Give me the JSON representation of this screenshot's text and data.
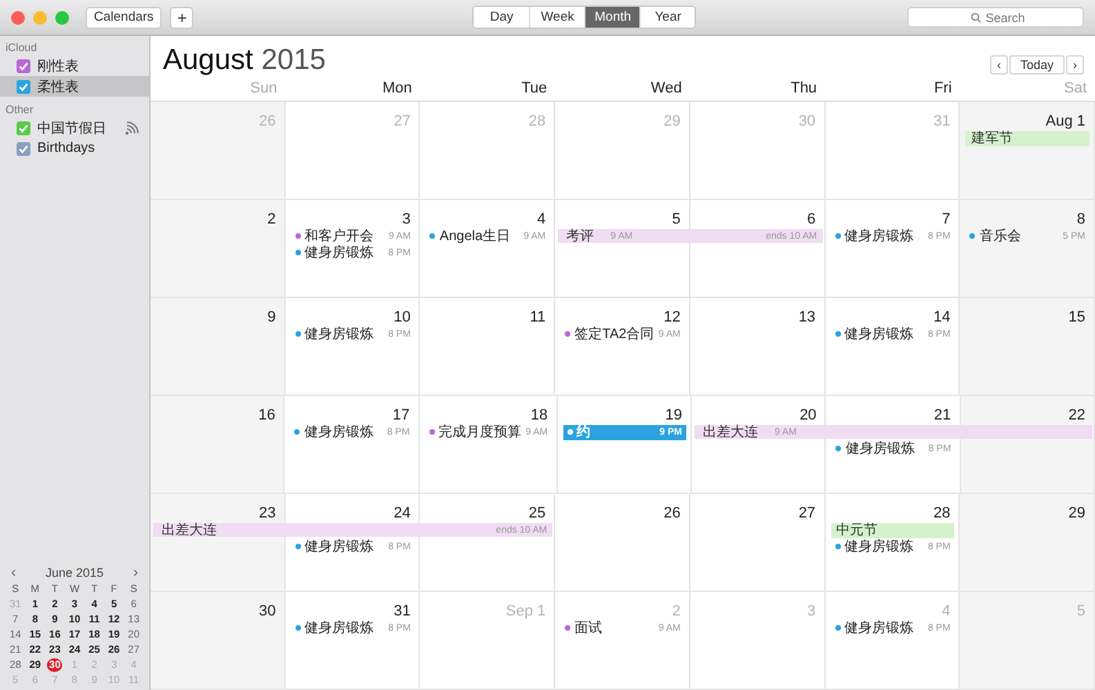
{
  "toolbar": {
    "calendars_button": "Calendars",
    "add_button": "+",
    "views": [
      {
        "label": "Day",
        "selected": false
      },
      {
        "label": "Week",
        "selected": false
      },
      {
        "label": "Month",
        "selected": true
      },
      {
        "label": "Year",
        "selected": false
      }
    ],
    "search": {
      "placeholder": "Search"
    }
  },
  "sidebar": {
    "groups": [
      {
        "title": "iCloud",
        "calendars": [
          {
            "name": "刚性表",
            "color": "#b968d6",
            "checked": true,
            "selected": false,
            "kind": "local"
          },
          {
            "name": "柔性表",
            "color": "#2aa3e0",
            "checked": true,
            "selected": true,
            "kind": "local"
          }
        ]
      },
      {
        "title": "Other",
        "calendars": [
          {
            "name": "中国节假日",
            "color": "#5cc94a",
            "checked": true,
            "selected": false,
            "kind": "subscribed"
          },
          {
            "name": "Birthdays",
            "color": "#8a9fbd",
            "checked": true,
            "selected": false,
            "kind": "local"
          }
        ]
      }
    ],
    "mini_calendar": {
      "title": "June 2015",
      "prev": "‹",
      "next": "›",
      "weekdays": [
        "S",
        "M",
        "T",
        "W",
        "T",
        "F",
        "S"
      ],
      "weeks": [
        [
          {
            "d": "31",
            "muted": true,
            "today": false
          },
          {
            "d": "1",
            "muted": false,
            "today": false
          },
          {
            "d": "2",
            "muted": false,
            "today": false
          },
          {
            "d": "3",
            "muted": false,
            "today": false
          },
          {
            "d": "4",
            "muted": false,
            "today": false
          },
          {
            "d": "5",
            "muted": false,
            "today": false
          },
          {
            "d": "6",
            "muted": false,
            "today": false
          }
        ],
        [
          {
            "d": "7",
            "muted": false,
            "today": false
          },
          {
            "d": "8",
            "muted": false,
            "today": false
          },
          {
            "d": "9",
            "muted": false,
            "today": false
          },
          {
            "d": "10",
            "muted": false,
            "today": false
          },
          {
            "d": "11",
            "muted": false,
            "today": false
          },
          {
            "d": "12",
            "muted": false,
            "today": false
          },
          {
            "d": "13",
            "muted": false,
            "today": false
          }
        ],
        [
          {
            "d": "14",
            "muted": false,
            "today": false
          },
          {
            "d": "15",
            "muted": false,
            "today": false
          },
          {
            "d": "16",
            "muted": false,
            "today": false
          },
          {
            "d": "17",
            "muted": false,
            "today": false
          },
          {
            "d": "18",
            "muted": false,
            "today": false
          },
          {
            "d": "19",
            "muted": false,
            "today": false
          },
          {
            "d": "20",
            "muted": false,
            "today": false
          }
        ],
        [
          {
            "d": "21",
            "muted": false,
            "today": false
          },
          {
            "d": "22",
            "muted": false,
            "today": false
          },
          {
            "d": "23",
            "muted": false,
            "today": false
          },
          {
            "d": "24",
            "muted": false,
            "today": false
          },
          {
            "d": "25",
            "muted": false,
            "today": false
          },
          {
            "d": "26",
            "muted": false,
            "today": false
          },
          {
            "d": "27",
            "muted": false,
            "today": false
          }
        ],
        [
          {
            "d": "28",
            "muted": false,
            "today": false
          },
          {
            "d": "29",
            "muted": false,
            "today": false
          },
          {
            "d": "30",
            "muted": false,
            "today": true
          },
          {
            "d": "1",
            "muted": true,
            "today": false
          },
          {
            "d": "2",
            "muted": true,
            "today": false
          },
          {
            "d": "3",
            "muted": true,
            "today": false
          },
          {
            "d": "4",
            "muted": true,
            "today": false
          }
        ],
        [
          {
            "d": "5",
            "muted": true,
            "today": false
          },
          {
            "d": "6",
            "muted": true,
            "today": false
          },
          {
            "d": "7",
            "muted": true,
            "today": false
          },
          {
            "d": "8",
            "muted": true,
            "today": false
          },
          {
            "d": "9",
            "muted": true,
            "today": false
          },
          {
            "d": "10",
            "muted": true,
            "today": false
          },
          {
            "d": "11",
            "muted": true,
            "today": false
          }
        ]
      ]
    }
  },
  "month": {
    "title_month": "August",
    "title_year": "2015",
    "prev": "‹",
    "today": "Today",
    "next": "›",
    "weekdays": [
      "Sun",
      "Mon",
      "Tue",
      "Wed",
      "Thu",
      "Fri",
      "Sat"
    ],
    "weeks": [
      {
        "days": [
          {
            "label": "26",
            "muted": true,
            "bar_continues": false
          },
          {
            "label": "27",
            "muted": true,
            "bar_continues": false
          },
          {
            "label": "28",
            "muted": true,
            "bar_continues": false
          },
          {
            "label": "29",
            "muted": true,
            "bar_continues": false
          },
          {
            "label": "30",
            "muted": true,
            "bar_continues": false
          },
          {
            "label": "31",
            "muted": true,
            "bar_continues": false
          },
          {
            "label": "Aug 1",
            "muted": false,
            "bar_continues": false,
            "events": [
              {
                "kind": "allday",
                "title": "建军节",
                "color": "#d6f2cd"
              }
            ]
          }
        ]
      },
      {
        "days": [
          {
            "label": "2",
            "muted": false,
            "bar_continues": false
          },
          {
            "label": "3",
            "muted": false,
            "bar_continues": false,
            "events": [
              {
                "kind": "timed",
                "title": "和客户开会",
                "time": "9 AM",
                "color": "#b968d6",
                "selected": false
              },
              {
                "kind": "timed",
                "title": "健身房锻炼",
                "time": "8 PM",
                "color": "#2aa3e0",
                "selected": false
              }
            ]
          },
          {
            "label": "4",
            "muted": false,
            "bar_continues": false,
            "events": [
              {
                "kind": "timed",
                "title": "Angela生日",
                "time": "9 AM",
                "color": "#2aa3e0",
                "selected": false
              }
            ]
          },
          {
            "label": "5",
            "muted": false,
            "bar_continues": false,
            "events": [
              {
                "kind": "multiday",
                "title": "考评",
                "time": "9 AM",
                "end": "ends 10 AM",
                "color": "#f0dcf3"
              }
            ]
          },
          {
            "label": "6",
            "muted": false,
            "bar_continues": true
          },
          {
            "label": "7",
            "muted": false,
            "bar_continues": false,
            "events": [
              {
                "kind": "timed",
                "title": "健身房锻炼",
                "time": "8 PM",
                "color": "#2aa3e0",
                "selected": false
              }
            ]
          },
          {
            "label": "8",
            "muted": false,
            "bar_continues": false,
            "events": [
              {
                "kind": "timed",
                "title": "音乐会",
                "time": "5 PM",
                "color": "#2aa3e0",
                "selected": false
              }
            ]
          }
        ]
      },
      {
        "days": [
          {
            "label": "9",
            "muted": false,
            "bar_continues": false
          },
          {
            "label": "10",
            "muted": false,
            "bar_continues": false,
            "events": [
              {
                "kind": "timed",
                "title": "健身房锻炼",
                "time": "8 PM",
                "color": "#2aa3e0",
                "selected": false
              }
            ]
          },
          {
            "label": "11",
            "muted": false,
            "bar_continues": false
          },
          {
            "label": "12",
            "muted": false,
            "bar_continues": false,
            "events": [
              {
                "kind": "timed",
                "title": "签定TA2合同",
                "time": "9 AM",
                "color": "#b968d6",
                "selected": false
              }
            ]
          },
          {
            "label": "13",
            "muted": false,
            "bar_continues": false
          },
          {
            "label": "14",
            "muted": false,
            "bar_continues": false,
            "events": [
              {
                "kind": "timed",
                "title": "健身房锻炼",
                "time": "8 PM",
                "color": "#2aa3e0",
                "selected": false
              }
            ]
          },
          {
            "label": "15",
            "muted": false,
            "bar_continues": false
          }
        ]
      },
      {
        "days": [
          {
            "label": "16",
            "muted": false,
            "bar_continues": false
          },
          {
            "label": "17",
            "muted": false,
            "bar_continues": false,
            "events": [
              {
                "kind": "timed",
                "title": "健身房锻炼",
                "time": "8 PM",
                "color": "#2aa3e0",
                "selected": false
              }
            ]
          },
          {
            "label": "18",
            "muted": false,
            "bar_continues": false,
            "events": [
              {
                "kind": "timed",
                "title": "完成月度预算",
                "time": "9 AM",
                "color": "#b968d6",
                "selected": false
              }
            ]
          },
          {
            "label": "19",
            "muted": false,
            "bar_continues": false,
            "events": [
              {
                "kind": "timed",
                "title": "约",
                "time": "9 PM",
                "color": "#2aa3e0",
                "selected": true
              }
            ]
          },
          {
            "label": "20",
            "muted": false,
            "bar_continues": false,
            "events": [
              {
                "kind": "multiday",
                "title": "出差大连",
                "time": "9 AM",
                "color": "#f0dcf3"
              }
            ]
          },
          {
            "label": "21",
            "muted": false,
            "bar_continues": true,
            "events": [
              {
                "kind": "timed",
                "title": "健身房锻炼",
                "time": "8 PM",
                "color": "#2aa3e0",
                "selected": false
              }
            ]
          },
          {
            "label": "22",
            "muted": false,
            "bar_continues": true
          }
        ]
      },
      {
        "days": [
          {
            "label": "23",
            "muted": false,
            "bar_continues": false,
            "events": [
              {
                "kind": "multiday",
                "title": "出差大连",
                "end": "ends 10 AM",
                "color": "#f0dcf3"
              }
            ]
          },
          {
            "label": "24",
            "muted": false,
            "bar_continues": true,
            "events": [
              {
                "kind": "timed",
                "title": "健身房锻炼",
                "time": "8 PM",
                "color": "#2aa3e0",
                "selected": false
              }
            ]
          },
          {
            "label": "25",
            "muted": false,
            "bar_continues": true
          },
          {
            "label": "26",
            "muted": false,
            "bar_continues": false
          },
          {
            "label": "27",
            "muted": false,
            "bar_continues": false
          },
          {
            "label": "28",
            "muted": false,
            "bar_continues": false,
            "events": [
              {
                "kind": "allday",
                "title": "中元节",
                "color": "#d6f2cd"
              },
              {
                "kind": "timed",
                "title": "健身房锻炼",
                "time": "8 PM",
                "color": "#2aa3e0",
                "selected": false
              }
            ]
          },
          {
            "label": "29",
            "muted": false,
            "bar_continues": false
          }
        ]
      },
      {
        "days": [
          {
            "label": "30",
            "muted": false,
            "bar_continues": false
          },
          {
            "label": "31",
            "muted": false,
            "bar_continues": false,
            "events": [
              {
                "kind": "timed",
                "title": "健身房锻炼",
                "time": "8 PM",
                "color": "#2aa3e0",
                "selected": false
              }
            ]
          },
          {
            "label": "Sep 1",
            "muted": true,
            "bar_continues": false
          },
          {
            "label": "2",
            "muted": true,
            "bar_continues": false,
            "events": [
              {
                "kind": "timed",
                "title": "面试",
                "time": "9 AM",
                "color": "#b968d6",
                "selected": false
              }
            ]
          },
          {
            "label": "3",
            "muted": true,
            "bar_continues": false
          },
          {
            "label": "4",
            "muted": true,
            "bar_continues": false,
            "events": [
              {
                "kind": "timed",
                "title": "健身房锻炼",
                "time": "8 PM",
                "color": "#2aa3e0",
                "selected": false
              }
            ]
          },
          {
            "label": "5",
            "muted": true,
            "bar_continues": false
          }
        ]
      }
    ]
  }
}
